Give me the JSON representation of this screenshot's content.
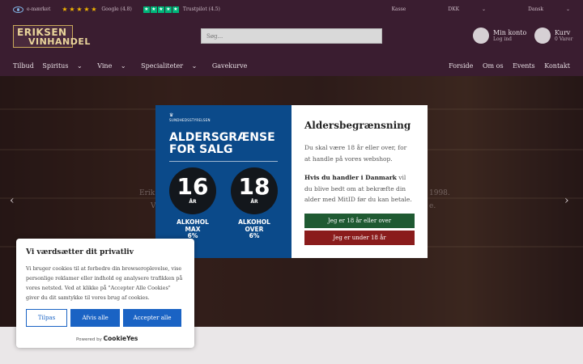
{
  "topbar": {
    "emaerket": "e-mærket",
    "google": "Google (4.8)",
    "trustpilot": "Trustpilot (4.5)",
    "right": [
      "Kasse",
      "DKK",
      "Dansk"
    ]
  },
  "header": {
    "logo_line1": "ERIKSEN",
    "logo_line2": "VINHANDEL",
    "search_placeholder": "Søg...",
    "account_title": "Min konto",
    "account_sub": "Log ind",
    "cart_title": "Kurv",
    "cart_sub": "0 Varer"
  },
  "nav": {
    "left": [
      "Tilbud",
      "Spiritus",
      "Vine",
      "Specialiteter",
      "Gavekurve"
    ],
    "right": [
      "Forside",
      "Om os",
      "Events",
      "Kontakt"
    ]
  },
  "hero": {
    "blur_left": "Erik",
    "blur_left2": "V",
    "blur_right": "1998.",
    "blur_right2": "e."
  },
  "age_modal": {
    "poster": {
      "agency": "SUNDHEDSSTYRELSEN",
      "headline1": "ALDERSGRÆNSE",
      "headline2": "FOR SALG",
      "age1": "16",
      "age2": "18",
      "unit": "ÅR",
      "cap1_l1": "ALKOHOL",
      "cap1_l2": "MAX",
      "cap1_l3": "6%",
      "cap2_l1": "ALKOHOL",
      "cap2_l2": "OVER",
      "cap2_l3": "6%"
    },
    "title": "Aldersbegrænsning",
    "text1": "Du skal være 18 år eller over, for at handle på vores webshop.",
    "text2_bold": "Hvis du handler i Danmark",
    "text2_rest": " vil du blive bedt om at bekræfte din alder med MitID før du kan betale.",
    "btn_over": "Jeg er 18 år eller over",
    "btn_under": "Jeg er under 18 år"
  },
  "cookie": {
    "title": "Vi værdsætter dit privatliv",
    "text": "Vi bruger cookies til at forbedre din browseroplevelse, vise personlige reklamer eller indhold og analysere trafikken på vores netsted. Ved at klikke på \"Accepter Alle Cookies\" giver du dit samtykke til vores brug af cookies.",
    "btn_customize": "Tilpas",
    "btn_reject": "Afvis alle",
    "btn_accept": "Accepter alle",
    "powered_prefix": "Powered by",
    "powered_brand": "CookieYes"
  }
}
